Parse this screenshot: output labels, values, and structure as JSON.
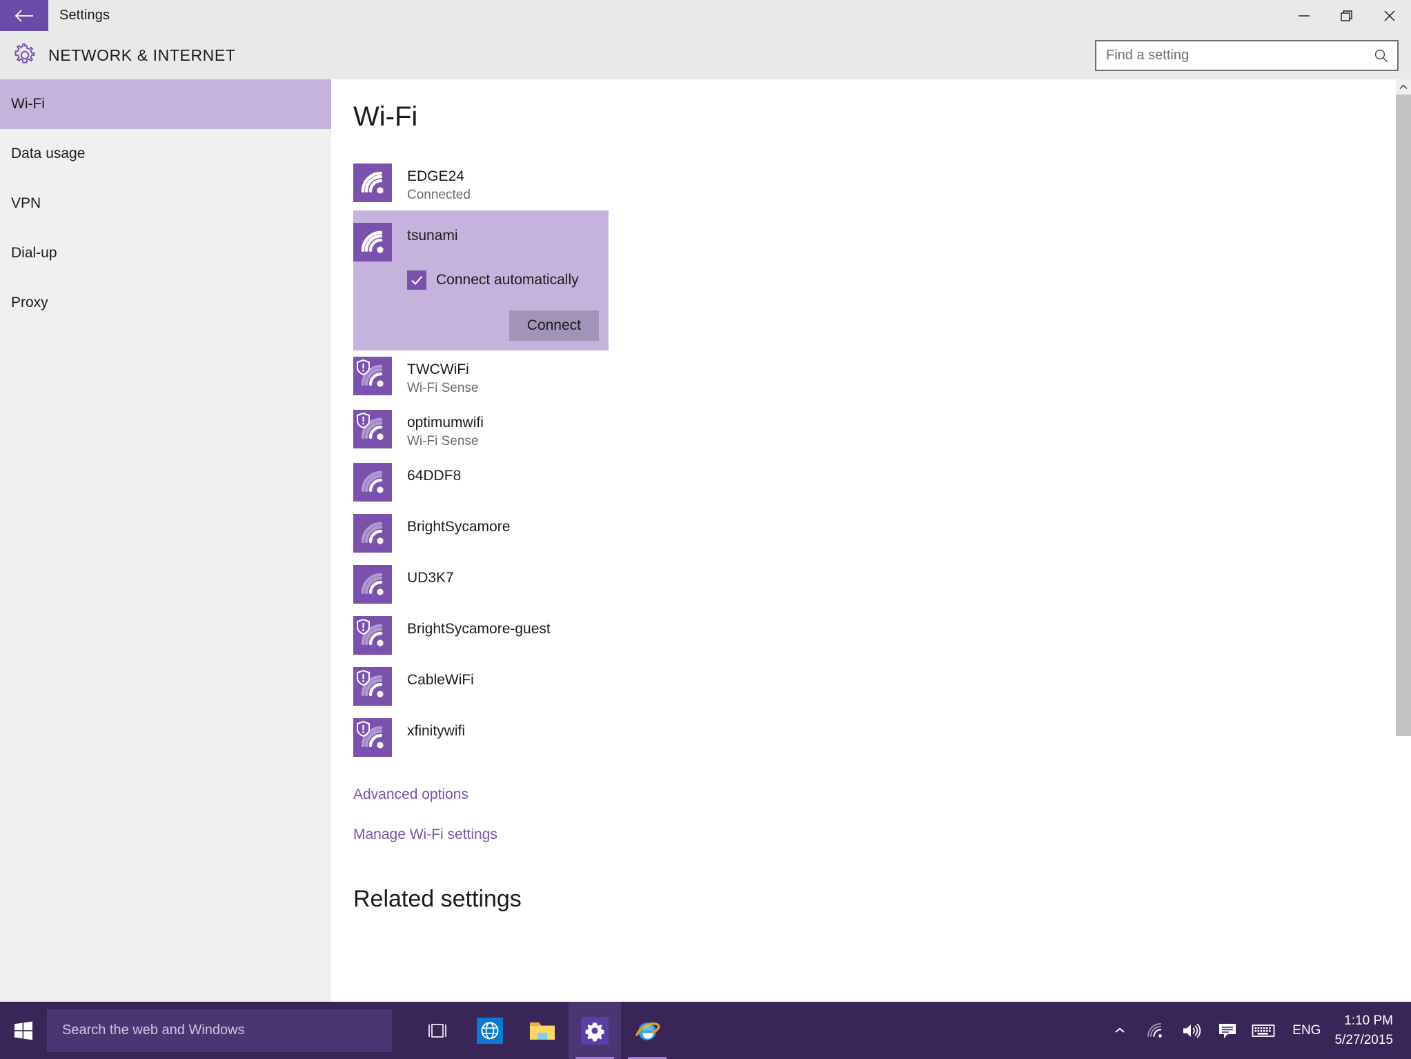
{
  "window": {
    "title": "Settings",
    "back_icon": "back-arrow-icon",
    "minimize_icon": "minimize-icon",
    "restore_icon": "restore-icon",
    "close_icon": "close-icon"
  },
  "header": {
    "gear_icon": "gear-icon",
    "title": "NETWORK & INTERNET",
    "search_placeholder": "Find a setting",
    "search_value": "",
    "search_icon": "search-icon"
  },
  "sidebar": {
    "items": [
      {
        "label": "Wi-Fi",
        "selected": true
      },
      {
        "label": "Data usage",
        "selected": false
      },
      {
        "label": "VPN",
        "selected": false
      },
      {
        "label": "Dial-up",
        "selected": false
      },
      {
        "label": "Proxy",
        "selected": false
      }
    ]
  },
  "main": {
    "page_title": "Wi-Fi",
    "networks": [
      {
        "name": "EDGE24",
        "status": "Connected",
        "secured": false,
        "bars": 4,
        "expanded": false
      },
      {
        "name": "tsunami",
        "status": "",
        "secured": false,
        "bars": 4,
        "expanded": true
      },
      {
        "name": "TWCWiFi",
        "status": "Wi-Fi Sense",
        "secured": true,
        "bars": 2,
        "expanded": false
      },
      {
        "name": "optimumwifi",
        "status": "Wi-Fi Sense",
        "secured": true,
        "bars": 2,
        "expanded": false
      },
      {
        "name": "64DDF8",
        "status": "",
        "secured": false,
        "bars": 2,
        "expanded": false
      },
      {
        "name": "BrightSycamore",
        "status": "",
        "secured": false,
        "bars": 2,
        "expanded": false
      },
      {
        "name": "UD3K7",
        "status": "",
        "secured": false,
        "bars": 2,
        "expanded": false
      },
      {
        "name": "BrightSycamore-guest",
        "status": "",
        "secured": true,
        "bars": 2,
        "expanded": false
      },
      {
        "name": "CableWiFi",
        "status": "",
        "secured": true,
        "bars": 2,
        "expanded": false
      },
      {
        "name": "xfinitywifi",
        "status": "",
        "secured": true,
        "bars": 2,
        "expanded": false
      }
    ],
    "expanded_card": {
      "connect_automatically_label": "Connect automatically",
      "connect_automatically_checked": true,
      "connect_button_label": "Connect"
    },
    "links": [
      {
        "label": "Advanced options"
      },
      {
        "label": "Manage Wi-Fi settings"
      }
    ],
    "related_heading": "Related settings"
  },
  "scrollbar": {
    "up_arrow_icon": "chevron-up-icon"
  },
  "taskbar": {
    "start_icon": "windows-start-icon",
    "search_placeholder": "Search the web and Windows",
    "apps": [
      {
        "name": "task-view",
        "icon": "task-view-icon",
        "running": false,
        "active": false
      },
      {
        "name": "edge",
        "icon": "edge-browser-icon",
        "running": false,
        "active": false
      },
      {
        "name": "file-explorer",
        "icon": "folder-icon",
        "running": false,
        "active": false
      },
      {
        "name": "settings",
        "icon": "gear-icon",
        "running": true,
        "active": true
      },
      {
        "name": "internet-explorer",
        "icon": "internet-explorer-icon",
        "running": true,
        "active": false
      }
    ],
    "tray": {
      "show_hidden_icon": "chevron-up-icon",
      "network_icon": "wifi-icon",
      "volume_icon": "speaker-icon",
      "action_center_icon": "action-center-icon",
      "keyboard_icon": "keyboard-icon",
      "language": "ENG",
      "time": "1:10 PM",
      "date": "5/27/2015"
    }
  },
  "colors": {
    "accent": "#7a52ae",
    "accent_dark": "#6b4ba8",
    "accent_light": "#c5b3dd",
    "chrome": "#e9e9e9",
    "sidebar": "#f0f0f0",
    "taskbar": "#3a2558"
  }
}
